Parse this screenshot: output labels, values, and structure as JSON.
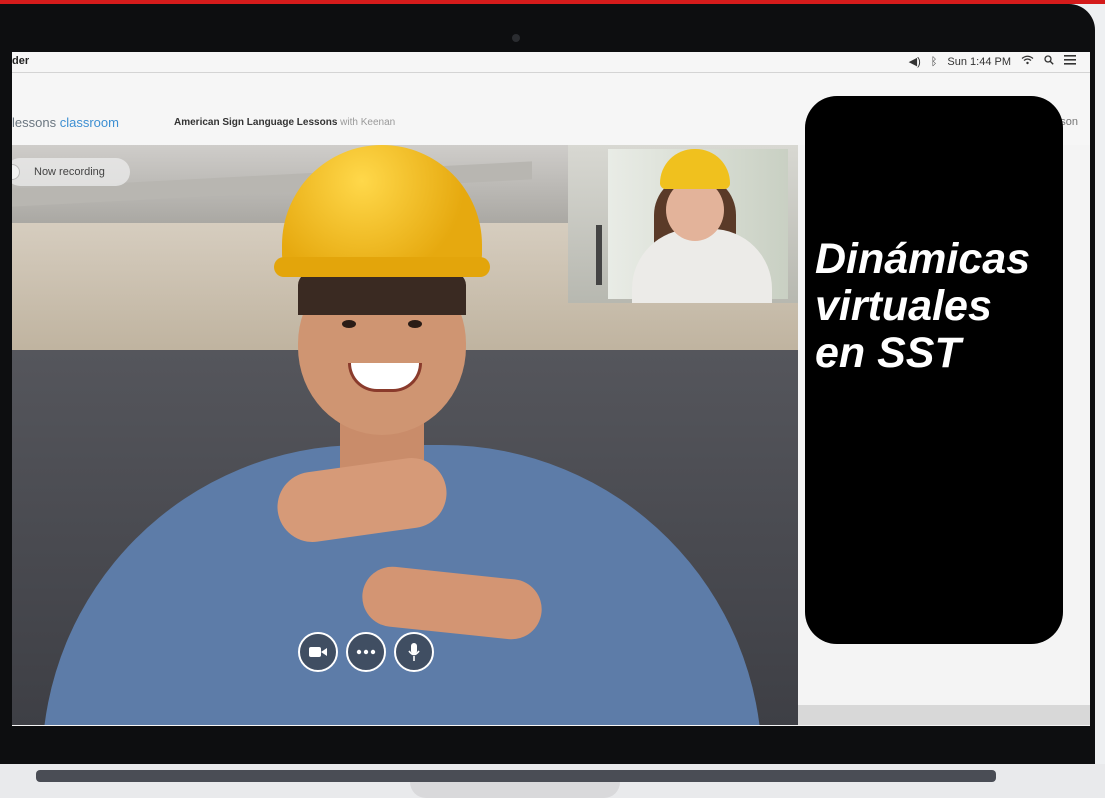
{
  "menubar": {
    "app_name": "der",
    "volume_icon": "volume-icon",
    "bluetooth_icon": "bluetooth-icon",
    "clock": "Sun 1:44 PM",
    "wifi_icon": "wifi-icon",
    "search_icon": "search-icon",
    "list_icon": "list-icon"
  },
  "header": {
    "logo_primary": "lessons",
    "logo_accent": "classroom",
    "lesson_title_bold": "American Sign Language Lessons",
    "lesson_title_light": "with Keenan",
    "leave_label": "Leave Lesson"
  },
  "video": {
    "recording_label": "Now recording"
  },
  "controls": [
    {
      "icon": "camera-icon"
    },
    {
      "icon": "more-icon"
    },
    {
      "icon": "microphone-icon"
    }
  ],
  "promo": {
    "line1": "Dinámicas",
    "line2": "virtuales",
    "line3": "en SST"
  },
  "colors": {
    "accent_blue": "#3d8fd2",
    "top_strip_red": "#d41b1b",
    "helmet_yellow": "#f0c11e"
  }
}
